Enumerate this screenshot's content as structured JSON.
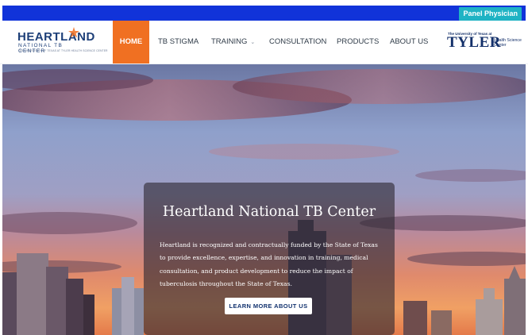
{
  "topbar": {
    "panel_label": "Panel Physician"
  },
  "logo": {
    "word": "HEARTLAND",
    "subtitle": "NATIONAL TB CENTER",
    "tagline": "THE UNIVERSITY OF TEXAS AT TYLER HEALTH SCIENCE CENTER"
  },
  "nav": {
    "items": [
      {
        "label": "HOME",
        "active": true
      },
      {
        "label": "TB STIGMA"
      },
      {
        "label": "TRAINING",
        "dropdown": true
      },
      {
        "label": "CONSULTATION"
      },
      {
        "label": "PRODUCTS"
      },
      {
        "label": "ABOUT US"
      }
    ]
  },
  "partner_logo": {
    "line1": "The University of Texas at",
    "line2": "TYLER",
    "line3": "Health Science Center"
  },
  "hero": {
    "title": "Heartland National TB Center",
    "body": "Heartland is recognized and contractually funded by the State of Texas to provide excellence, expertise, and innovation in training, medical consultation, and product development to reduce the impact of tuberculosis throughout the State of Texas.",
    "cta": "LEARN MORE ABOUT US"
  },
  "colors": {
    "topbar_blue": "#1133d9",
    "panel_button": "#1fb3c4",
    "nav_active": "#f07022",
    "brand_navy": "#1d3f78"
  }
}
